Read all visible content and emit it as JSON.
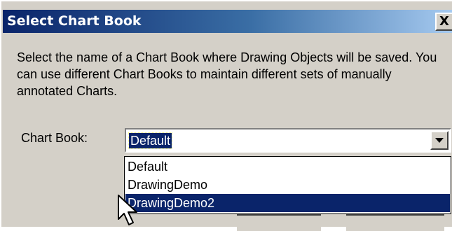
{
  "window": {
    "title": "Select Chart Book",
    "close_glyph": "X"
  },
  "description": "Select the name of a Chart Book where Drawing Objects will be saved.  You can use different Chart Books to maintain different sets of manually annotated Charts.",
  "chart_book": {
    "label": "Chart Book:",
    "selected_value": "Default",
    "options": [
      "Default",
      "DrawingDemo",
      "DrawingDemo2"
    ],
    "highlighted_option": "DrawingDemo2"
  },
  "colors": {
    "title_bar_start": "#0a246a",
    "title_bar_end": "#a6caf0",
    "dialog_face": "#d4d0c8",
    "selection": "#0a246a"
  },
  "icons": {
    "close": "close-icon",
    "dropdown": "chevron-down-icon",
    "cursor": "mouse-pointer-icon"
  }
}
